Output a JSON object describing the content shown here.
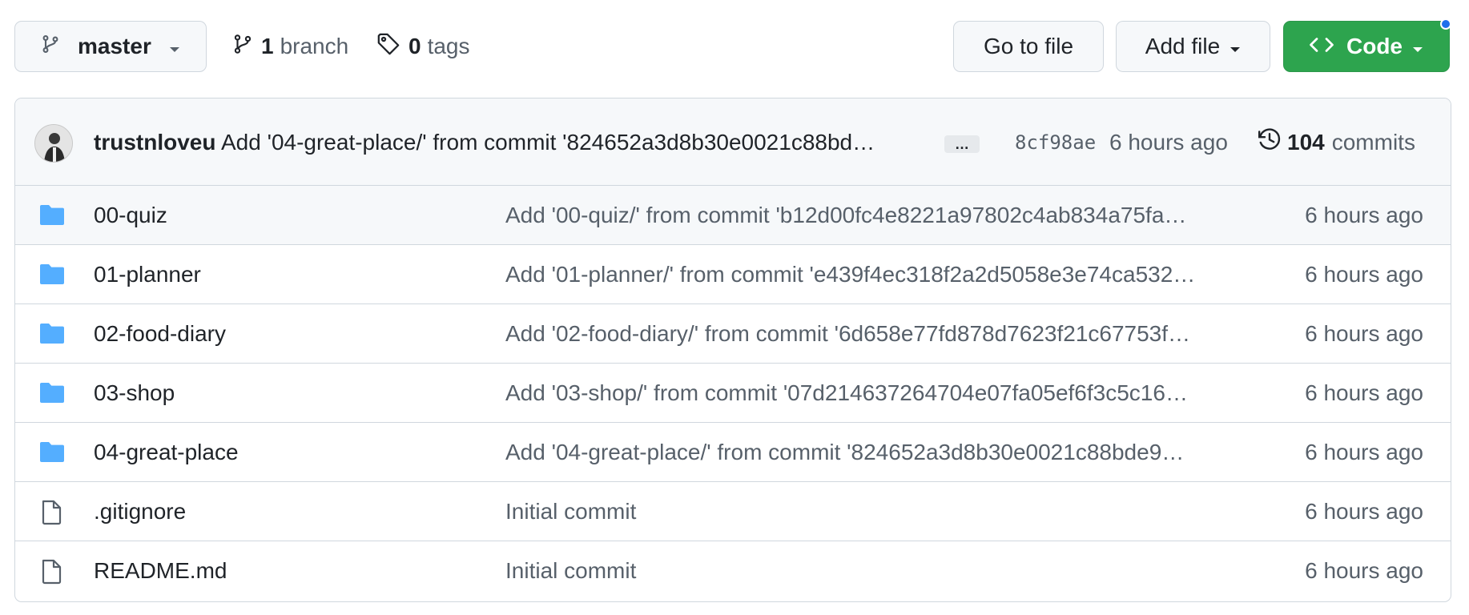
{
  "toolbar": {
    "branch_select": "master",
    "branch_count": "1",
    "branch_label": "branch",
    "tag_count": "0",
    "tag_label": "tags",
    "go_to_file": "Go to file",
    "add_file": "Add file",
    "code": "Code"
  },
  "latest_commit": {
    "author": "trustnloveu",
    "message": "Add '04-great-place/' from commit '824652a3d8b30e0021c88bd…",
    "ellipsis": "…",
    "sha": "8cf98ae",
    "time": "6 hours ago",
    "commit_count": "104",
    "commit_label": "commits"
  },
  "files": [
    {
      "name": "00-quiz",
      "type": "folder",
      "message": "Add '00-quiz/' from commit 'b12d00fc4e8221a97802c4ab834a75fa…",
      "time": "6 hours ago"
    },
    {
      "name": "01-planner",
      "type": "folder",
      "message": "Add '01-planner/' from commit 'e439f4ec318f2a2d5058e3e74ca532…",
      "time": "6 hours ago"
    },
    {
      "name": "02-food-diary",
      "type": "folder",
      "message": "Add '02-food-diary/' from commit '6d658e77fd878d7623f21c67753f…",
      "time": "6 hours ago"
    },
    {
      "name": "03-shop",
      "type": "folder",
      "message": "Add '03-shop/' from commit '07d214637264704e07fa05ef6f3c5c16…",
      "time": "6 hours ago"
    },
    {
      "name": "04-great-place",
      "type": "folder",
      "message": "Add '04-great-place/' from commit '824652a3d8b30e0021c88bde9…",
      "time": "6 hours ago"
    },
    {
      "name": ".gitignore",
      "type": "file",
      "message": "Initial commit",
      "time": "6 hours ago"
    },
    {
      "name": "README.md",
      "type": "file",
      "message": "Initial commit",
      "time": "6 hours ago"
    }
  ],
  "colors": {
    "folder_icon": "#54aeff",
    "code_button": "#2da44e",
    "notification_dot": "#1f6feb"
  }
}
